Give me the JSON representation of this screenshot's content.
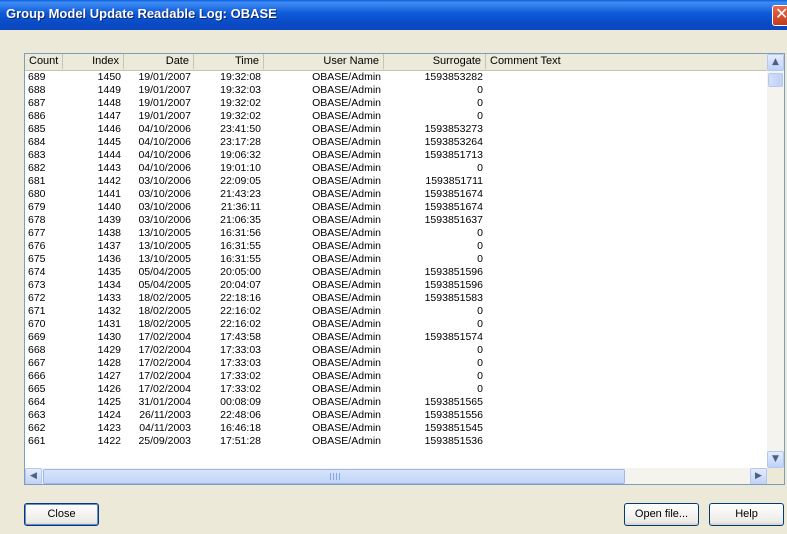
{
  "window": {
    "title": "Group Model Update Readable Log: OBASE",
    "close_glyph": "✕",
    "close_icon": "close-icon"
  },
  "table": {
    "columns": [
      "Count",
      "Index",
      "Date",
      "Time",
      "User Name",
      "Surrogate",
      "Comment Text"
    ],
    "rows": [
      [
        "689",
        "1450",
        "19/01/2007",
        "19:32:08",
        "OBASE/Admin",
        "1593853282",
        ""
      ],
      [
        "688",
        "1449",
        "19/01/2007",
        "19:32:03",
        "OBASE/Admin",
        "0",
        ""
      ],
      [
        "687",
        "1448",
        "19/01/2007",
        "19:32:02",
        "OBASE/Admin",
        "0",
        ""
      ],
      [
        "686",
        "1447",
        "19/01/2007",
        "19:32:02",
        "OBASE/Admin",
        "0",
        ""
      ],
      [
        "685",
        "1446",
        "04/10/2006",
        "23:41:50",
        "OBASE/Admin",
        "1593853273",
        ""
      ],
      [
        "684",
        "1445",
        "04/10/2006",
        "23:17:28",
        "OBASE/Admin",
        "1593853264",
        ""
      ],
      [
        "683",
        "1444",
        "04/10/2006",
        "19:06:32",
        "OBASE/Admin",
        "1593851713",
        ""
      ],
      [
        "682",
        "1443",
        "04/10/2006",
        "19:01:10",
        "OBASE/Admin",
        "0",
        ""
      ],
      [
        "681",
        "1442",
        "03/10/2006",
        "22:09:05",
        "OBASE/Admin",
        "1593851711",
        ""
      ],
      [
        "680",
        "1441",
        "03/10/2006",
        "21:43:23",
        "OBASE/Admin",
        "1593851674",
        ""
      ],
      [
        "679",
        "1440",
        "03/10/2006",
        "21:36:11",
        "OBASE/Admin",
        "1593851674",
        ""
      ],
      [
        "678",
        "1439",
        "03/10/2006",
        "21:06:35",
        "OBASE/Admin",
        "1593851637",
        ""
      ],
      [
        "677",
        "1438",
        "13/10/2005",
        "16:31:56",
        "OBASE/Admin",
        "0",
        ""
      ],
      [
        "676",
        "1437",
        "13/10/2005",
        "16:31:55",
        "OBASE/Admin",
        "0",
        ""
      ],
      [
        "675",
        "1436",
        "13/10/2005",
        "16:31:55",
        "OBASE/Admin",
        "0",
        ""
      ],
      [
        "674",
        "1435",
        "05/04/2005",
        "20:05:00",
        "OBASE/Admin",
        "1593851596",
        ""
      ],
      [
        "673",
        "1434",
        "05/04/2005",
        "20:04:07",
        "OBASE/Admin",
        "1593851596",
        ""
      ],
      [
        "672",
        "1433",
        "18/02/2005",
        "22:18:16",
        "OBASE/Admin",
        "1593851583",
        ""
      ],
      [
        "671",
        "1432",
        "18/02/2005",
        "22:16:02",
        "OBASE/Admin",
        "0",
        ""
      ],
      [
        "670",
        "1431",
        "18/02/2005",
        "22:16:02",
        "OBASE/Admin",
        "0",
        ""
      ],
      [
        "669",
        "1430",
        "17/02/2004",
        "17:43:58",
        "OBASE/Admin",
        "1593851574",
        ""
      ],
      [
        "668",
        "1429",
        "17/02/2004",
        "17:33:03",
        "OBASE/Admin",
        "0",
        ""
      ],
      [
        "667",
        "1428",
        "17/02/2004",
        "17:33:03",
        "OBASE/Admin",
        "0",
        ""
      ],
      [
        "666",
        "1427",
        "17/02/2004",
        "17:33:02",
        "OBASE/Admin",
        "0",
        ""
      ],
      [
        "665",
        "1426",
        "17/02/2004",
        "17:33:02",
        "OBASE/Admin",
        "0",
        ""
      ],
      [
        "664",
        "1425",
        "31/01/2004",
        "00:08:09",
        "OBASE/Admin",
        "1593851565",
        ""
      ],
      [
        "663",
        "1424",
        "26/11/2003",
        "22:48:06",
        "OBASE/Admin",
        "1593851556",
        ""
      ],
      [
        "662",
        "1423",
        "04/11/2003",
        "16:46:18",
        "OBASE/Admin",
        "1593851545",
        ""
      ],
      [
        "661",
        "1422",
        "25/09/2003",
        "17:51:28",
        "OBASE/Admin",
        "1593851536",
        ""
      ]
    ]
  },
  "scrollbars": {
    "up_glyph": "▲",
    "down_glyph": "▼",
    "left_glyph": "◀",
    "right_glyph": "▶"
  },
  "buttons": {
    "close_label": "Close",
    "open_file_label": "Open file...",
    "help_label": "Help"
  }
}
